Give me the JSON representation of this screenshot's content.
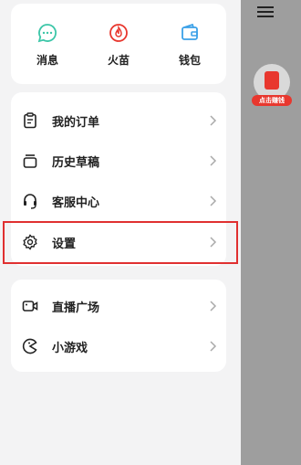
{
  "quick_actions": [
    {
      "label": "消息",
      "icon": "message-icon",
      "color": "#3cc6a8"
    },
    {
      "label": "火苗",
      "icon": "flame-icon",
      "color": "#e8372e"
    },
    {
      "label": "钱包",
      "icon": "wallet-icon",
      "color": "#3ba1e8"
    }
  ],
  "menu_items": [
    {
      "label": "我的订单",
      "icon": "order-icon"
    },
    {
      "label": "历史草稿",
      "icon": "draft-icon"
    },
    {
      "label": "客服中心",
      "icon": "headset-icon"
    },
    {
      "label": "设置",
      "icon": "gear-icon"
    }
  ],
  "extra_items": [
    {
      "label": "直播广场",
      "icon": "live-camera-icon"
    },
    {
      "label": "小游戏",
      "icon": "game-icon"
    }
  ],
  "promo": {
    "badge": "点击赚钱"
  },
  "colors": {
    "highlight": "#e03030",
    "accent_red": "#e8372e"
  }
}
